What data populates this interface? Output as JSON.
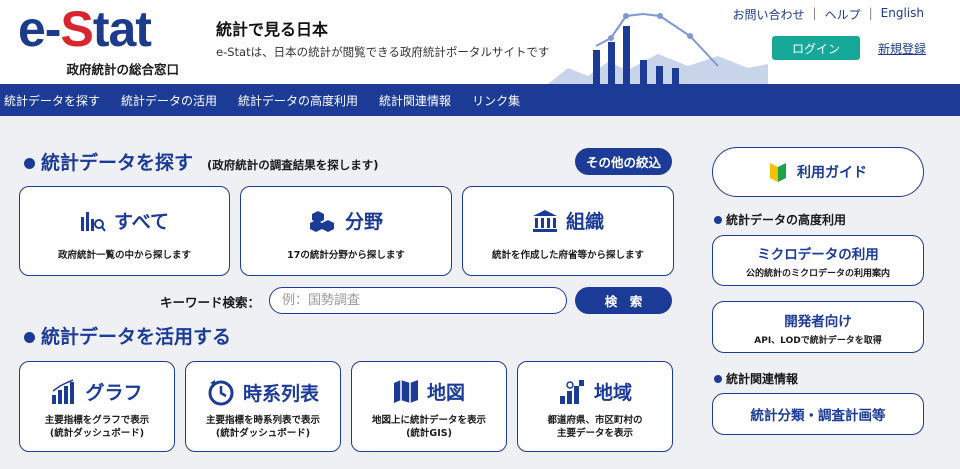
{
  "header": {
    "logo_prefix": "e-",
    "logo_s": "S",
    "logo_suffix": "tat",
    "logo_sub": "政府統計の総合窓口",
    "site_title": "統計で見る日本",
    "site_desc": "e-Statは、日本の統計が閲覧できる政府統計ポータルサイトです",
    "links": [
      "お問い合わせ",
      "ヘルプ",
      "English"
    ],
    "login_label": "ログイン",
    "signup_label": "新規登録"
  },
  "nav": {
    "items": [
      "統計データを探す",
      "統計データの活用",
      "統計データの高度利用",
      "統計関連情報",
      "リンク集"
    ]
  },
  "search_section": {
    "title": "統計データを探す",
    "subtitle": "(政府統計の調査結果を探します)",
    "filter_label": "その他の絞込",
    "cards": [
      {
        "title": "すべて",
        "desc": "政府統計一覧の中から探します",
        "icon": "bar-chart-search-icon"
      },
      {
        "title": "分野",
        "desc": "17の統計分野から探します",
        "icon": "cubes-icon"
      },
      {
        "title": "組織",
        "desc": "統計を作成した府省等から探します",
        "icon": "building-icon"
      }
    ],
    "keyword_label": "キーワード検索：",
    "keyword_placeholder": "例：国勢調査",
    "search_button": "検　索"
  },
  "use_section": {
    "title": "統計データを活用する",
    "cards": [
      {
        "title": "グラフ",
        "desc1": "主要指標をグラフで表示",
        "desc2": "(統計ダッシュボード)",
        "icon": "graph-icon"
      },
      {
        "title": "時系列表",
        "desc1": "主要指標を時系列表で表示",
        "desc2": "(統計ダッシュボード)",
        "icon": "clock-icon"
      },
      {
        "title": "地図",
        "desc1": "地図上に統計データを表示",
        "desc2": "(統計GIS)",
        "icon": "map-icon"
      },
      {
        "title": "地域",
        "desc1": "都道府県、市区町村の",
        "desc2": "主要データを表示",
        "icon": "region-icon"
      }
    ]
  },
  "sidebar": {
    "guide_label": "利用ガイド",
    "advanced_head": "統計データの高度利用",
    "micro_title": "ミクロデータの利用",
    "micro_desc": "公的統計のミクロデータの利用案内",
    "dev_title": "開発者向け",
    "dev_desc": "API、LODで統計データを取得",
    "related_head": "統計関連情報",
    "classification_title": "統計分類・調査計画等"
  },
  "colors": {
    "brand": "#1c3b96",
    "accent_red": "#d9262e",
    "login_teal": "#16a99a"
  }
}
